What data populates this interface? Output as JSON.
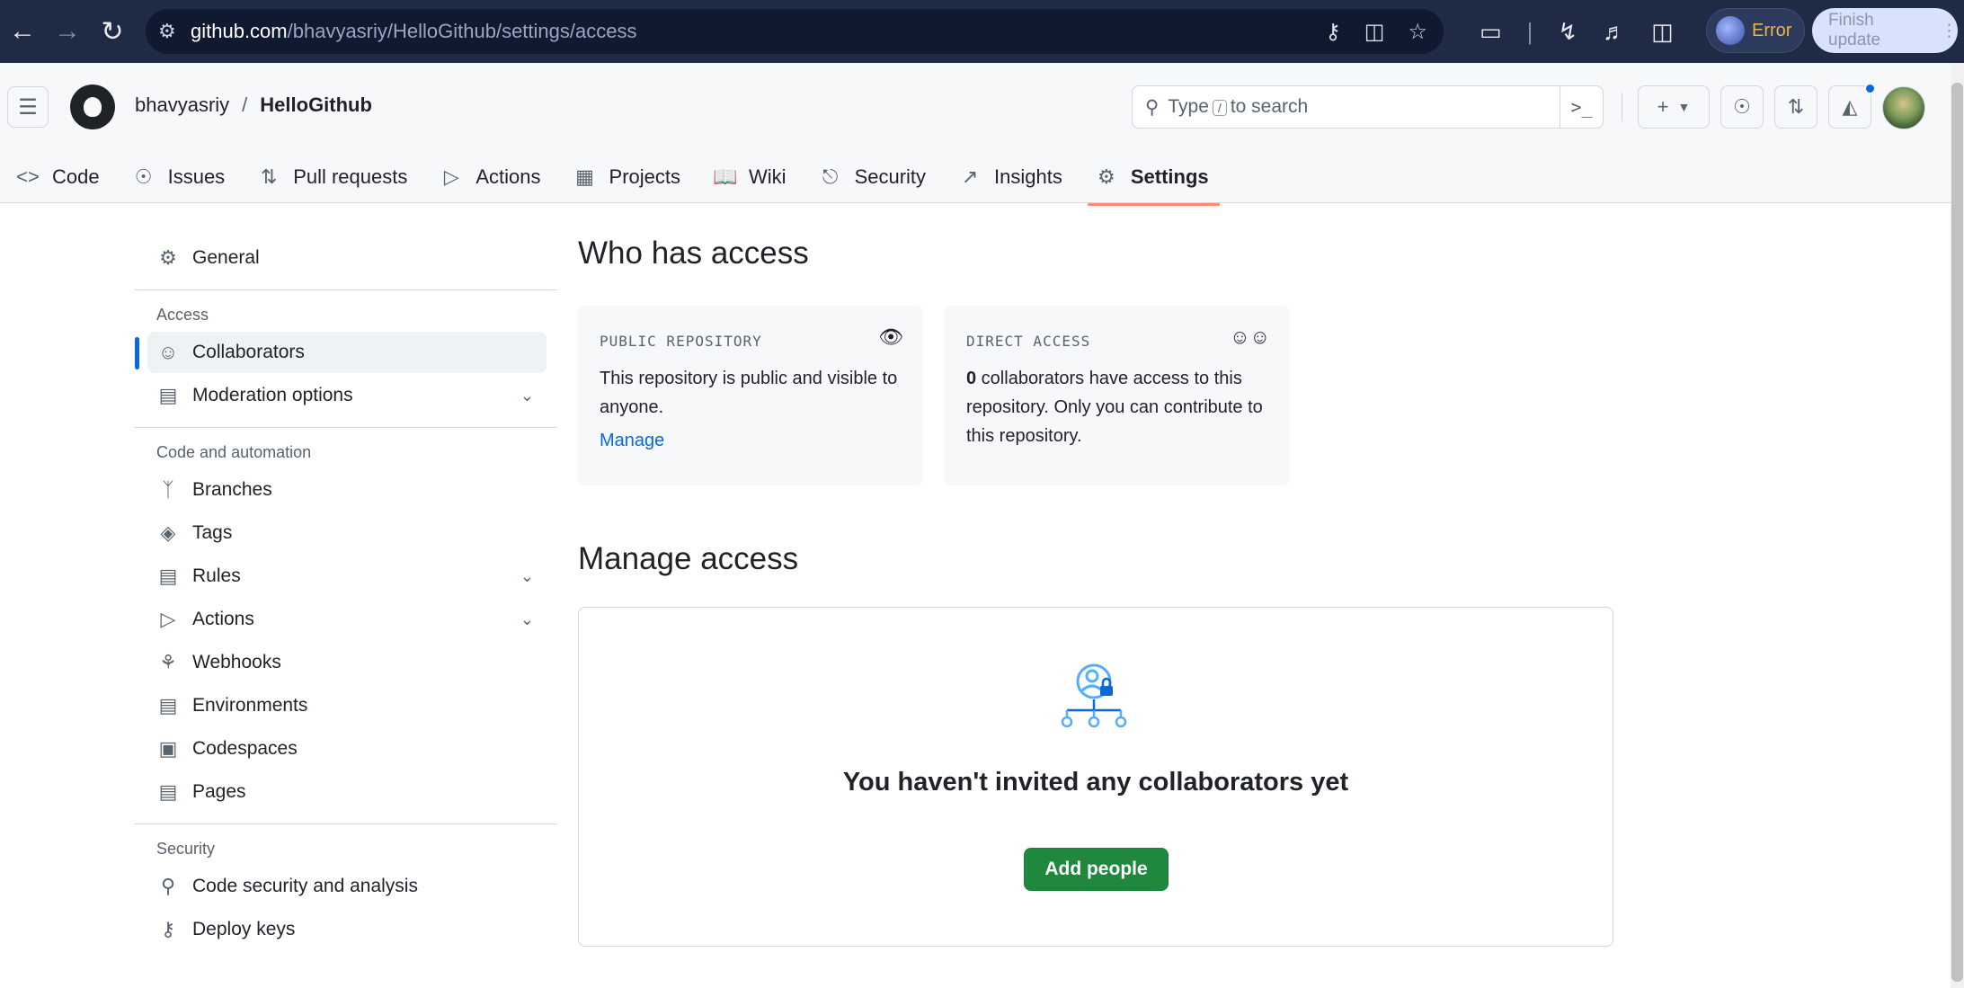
{
  "browser": {
    "url_host": "github.com",
    "url_path": "/bhavyasriy/HelloGithub/settings/access",
    "profile_status": "Error",
    "finish_update_label": "Finish update"
  },
  "header": {
    "owner": "bhavyasriy",
    "separator": "/",
    "repo": "HelloGithub",
    "search_prefix": "Type",
    "search_key": "/",
    "search_suffix": "to search"
  },
  "repo_nav": [
    {
      "label": "Code",
      "icon": "code-icon"
    },
    {
      "label": "Issues",
      "icon": "issue-icon"
    },
    {
      "label": "Pull requests",
      "icon": "pull-request-icon"
    },
    {
      "label": "Actions",
      "icon": "play-icon"
    },
    {
      "label": "Projects",
      "icon": "table-icon"
    },
    {
      "label": "Wiki",
      "icon": "book-icon"
    },
    {
      "label": "Security",
      "icon": "shield-icon"
    },
    {
      "label": "Insights",
      "icon": "graph-icon"
    },
    {
      "label": "Settings",
      "icon": "gear-icon",
      "selected": true
    }
  ],
  "sidebar": {
    "general": "General",
    "access_heading": "Access",
    "collaborators": "Collaborators",
    "moderation": "Moderation options",
    "code_heading": "Code and automation",
    "branches": "Branches",
    "tags": "Tags",
    "rules": "Rules",
    "actions": "Actions",
    "webhooks": "Webhooks",
    "environments": "Environments",
    "codespaces": "Codespaces",
    "pages": "Pages",
    "security_heading": "Security",
    "code_security": "Code security and analysis",
    "deploy_keys": "Deploy keys"
  },
  "main": {
    "who_title": "Who has access",
    "public_card": {
      "title": "PUBLIC REPOSITORY",
      "body": "This repository is public and visible to anyone.",
      "link": "Manage"
    },
    "direct_card": {
      "title": "DIRECT ACCESS",
      "count": "0",
      "body": " collaborators have access to this repository. Only you can contribute to this repository."
    },
    "manage_title": "Manage access",
    "blank_title": "You haven't invited any collaborators yet",
    "add_people": "Add people"
  },
  "colors": {
    "accent_blue": "#0969da",
    "primary_green": "#1f883d",
    "selected_underline": "#fd8c73",
    "chrome_bg": "#1f2a44"
  }
}
